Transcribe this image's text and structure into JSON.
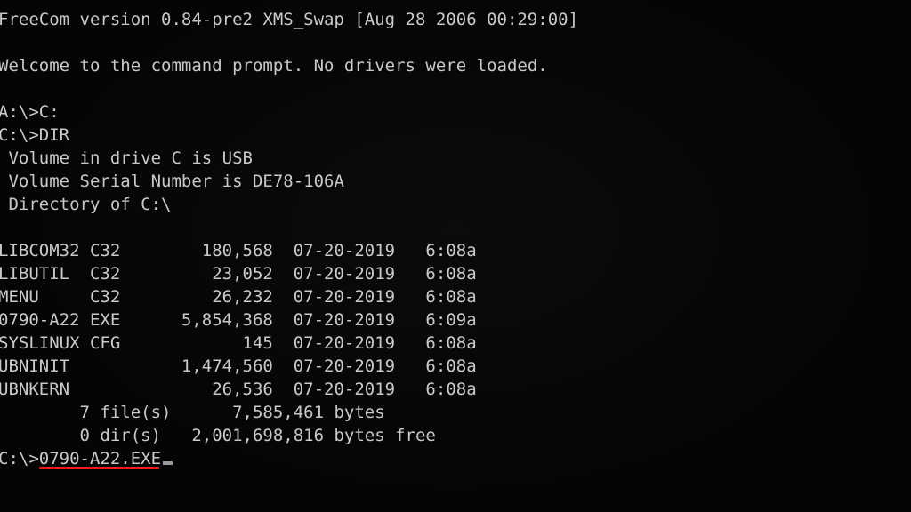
{
  "terminal": {
    "title": "FreeCom version 0.84-pre2 XMS_Swap [Aug 28 2006 00:29:00]",
    "background_color": "#050505",
    "text_color": "#c9c9c9",
    "annotation_color": "#e8201c",
    "cursor_color": "#9a9a9a",
    "banner": "FreeCom version 0.84-pre2 XMS_Swap [Aug 28 2006 00:29:00]",
    "welcome": "Welcome to the command prompt. No drivers were loaded.",
    "lines": [
      "FreeCom version 0.84-pre2 XMS_Swap [Aug 28 2006 00:29:00]",
      "",
      "Welcome to the command prompt. No drivers were loaded.",
      "",
      "A:\\>C:",
      "C:\\>DIR",
      " Volume in drive C is USB",
      " Volume Serial Number is DE78-106A",
      " Directory of C:\\",
      "",
      "LIBCOM32 C32        180,568  07-20-2019   6:08a",
      "LIBUTIL  C32         23,052  07-20-2019   6:08a",
      "MENU     C32         26,232  07-20-2019   6:08a",
      "0790-A22 EXE      5,854,368  07-20-2019   6:09a",
      "SYSLINUX CFG            145  07-20-2019   6:08a",
      "UBNINIT           1,474,560  07-20-2019   6:08a",
      "UBNKERN              26,536  07-20-2019   6:08a",
      "        7 file(s)      7,585,461 bytes",
      "        0 dir(s)   2,001,698,816 bytes free"
    ],
    "commands": {
      "change_drive": "A:\\>C:",
      "dir": "C:\\>DIR"
    },
    "volume": {
      "label_line": " Volume in drive C is USB",
      "serial_line": " Volume Serial Number is DE78-106A",
      "directory_line": " Directory of C:\\",
      "drive_letter": "C",
      "volume_name": "USB",
      "serial_number": "DE78-106A",
      "path": "C:\\"
    },
    "listing": {
      "files": [
        {
          "name": "LIBCOM32",
          "ext": "C32",
          "size": "180,568",
          "date": "07-20-2019",
          "time": "6:08a"
        },
        {
          "name": "LIBUTIL",
          "ext": "C32",
          "size": "23,052",
          "date": "07-20-2019",
          "time": "6:08a"
        },
        {
          "name": "MENU",
          "ext": "C32",
          "size": "26,232",
          "date": "07-20-2019",
          "time": "6:08a"
        },
        {
          "name": "0790-A22",
          "ext": "EXE",
          "size": "5,854,368",
          "date": "07-20-2019",
          "time": "6:09a"
        },
        {
          "name": "SYSLINUX",
          "ext": "CFG",
          "size": "145",
          "date": "07-20-2019",
          "time": "6:08a"
        },
        {
          "name": "UBNINIT",
          "ext": "",
          "size": "1,474,560",
          "date": "07-20-2019",
          "time": "6:08a"
        },
        {
          "name": "UBNKERN",
          "ext": "",
          "size": "26,536",
          "date": "07-20-2019",
          "time": "6:08a"
        }
      ],
      "summary": {
        "file_count_line": "        7 file(s)      7,585,461 bytes",
        "dir_count_line": "        0 dir(s)   2,001,698,816 bytes free",
        "file_count": "7",
        "total_bytes": "7,585,461",
        "dir_count": "0",
        "free_bytes": "2,001,698,816"
      }
    },
    "active_prompt": {
      "prefix": "C:\\>",
      "typed_command": "0790-A22.EXE",
      "cursor": "_",
      "underlined": true
    }
  }
}
